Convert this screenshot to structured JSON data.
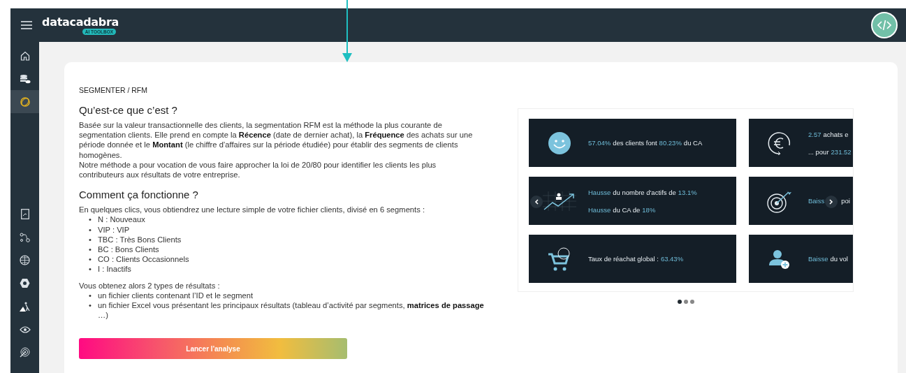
{
  "header": {
    "logo": "datacadabra",
    "badge": "AI TOOLBOX"
  },
  "sidebar": {
    "items": [
      {
        "selected": false
      },
      {
        "selected": false
      },
      {
        "selected": true
      },
      {
        "selected": false
      },
      {
        "selected": false
      },
      {
        "selected": false
      },
      {
        "selected": false
      },
      {
        "selected": false
      },
      {
        "selected": false
      },
      {
        "selected": false
      }
    ]
  },
  "breadcrumb": "SEGMENTER / RFM",
  "sections": [
    {
      "heading": "Qu’est-ce que c’est ?",
      "paragraphs": [
        "Basée sur la valeur transactionnelle des clients, la segmentation RFM est la méthode la plus courante de segmentation clients. Elle prend en compte la **Récence** (date de dernier achat), la **Fréquence** des achats sur une période donnée et le **Montant** (le chiffre d’affaires sur la période étudiée) pour établir des segments de clients homogènes.",
        "Notre méthode a pour vocation de vous faire approcher la loi de 20/80 pour identifier les clients les plus contributeurs aux résultats de votre entreprise."
      ]
    },
    {
      "heading": "Comment ça fonctionne ?",
      "intro": "En quelques clics, vous obtiendrez une lecture simple de votre fichier clients, divisé en 6 segments :",
      "items": [
        {
          "bullet": "•",
          "text": "N : Nouveaux"
        },
        {
          "bullet": "•",
          "text": "VIP : VIP"
        },
        {
          "bullet": "•",
          "text": "TBC : Très Bons Clients"
        },
        {
          "bullet": "•",
          "text": "BC : Bons Clients"
        },
        {
          "bullet": "•",
          "text": "CO : Clients Occasionnels"
        },
        {
          "bullet": "•",
          "text": "I : Inactifs"
        }
      ],
      "intro_2": "Vous obtenez alors 2 types de résultats :",
      "items_2": [
        {
          "bullet": "•",
          "text": "un fichier clients contenant l’ID et le segment"
        },
        {
          "bullet": "•",
          "text": "un fichier Excel vous présentant les principaux résultats (tableau d’activité par segments, **matrices de passage** …)"
        }
      ]
    }
  ],
  "action_button": "Lancer l'analyse",
  "carousel": {
    "slides": [
      {
        "tiles": [
          {
            "lines": [
              [
                {
                  "text": "57.04%",
                  "highlight": true
                },
                {
                  "text": "des clients font",
                  "highlight": false
                },
                {
                  "text": "80.23%",
                  "highlight": true
                },
                {
                  "text": "du CA",
                  "highlight": false
                }
              ]
            ]
          },
          {
            "lines": [
              [
                {
                  "text": "Hausse",
                  "highlight": true
                },
                {
                  "text": "du nombre d'actifs de",
                  "highlight": false
                },
                {
                  "text": "13.1%",
                  "highlight": true
                }
              ],
              [
                {
                  "text": "Hausse",
                  "highlight": true
                },
                {
                  "text": "du CA de",
                  "highlight": false
                },
                {
                  "text": "18%",
                  "highlight": true
                }
              ]
            ]
          },
          {
            "lines": [
              [
                {
                  "text": "Taux de réachat global :",
                  "highlight": false
                },
                {
                  "text": "63.43%",
                  "highlight": true
                }
              ]
            ]
          }
        ]
      },
      {
        "tiles": [
          {
            "lines": [
              [
                {
                  "text": "2.57",
                  "highlight": true
                },
                {
                  "text": "achats e",
                  "highlight": false
                }
              ],
              [
                {
                  "text": "... pour",
                  "highlight": false
                },
                {
                  "text": "231.52",
                  "highlight": true
                }
              ]
            ]
          },
          {
            "lines": [
              [
                {
                  "text": "Baiss",
                  "highlight": true
                },
                {
                  "text": "poi",
                  "highlight": false
                }
              ]
            ]
          },
          {
            "lines": [
              [
                {
                  "text": "Baisse",
                  "highlight": true
                },
                {
                  "text": "du vol",
                  "highlight": false
                }
              ]
            ]
          }
        ]
      }
    ],
    "dots": [
      {
        "selected": true
      },
      {
        "selected": false
      },
      {
        "selected": false
      }
    ]
  }
}
